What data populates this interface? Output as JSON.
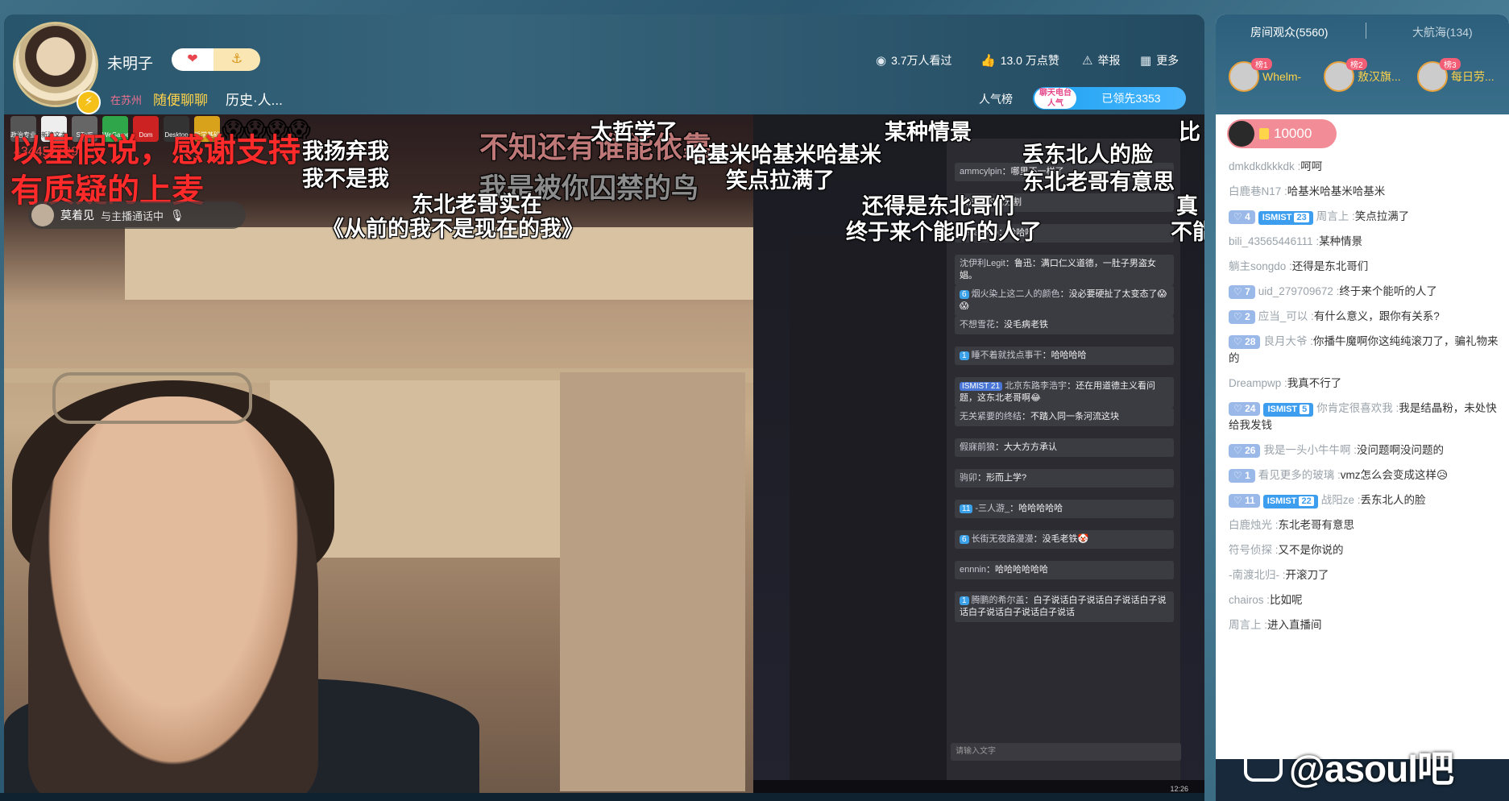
{
  "header": {
    "streamer_name": "未明子",
    "location": "在苏州",
    "category": "随便聊聊",
    "sub_category": "历史·人...",
    "viewers": "3.7万人看过",
    "likes": "13.0 万点赞",
    "report_label": "举报",
    "more_label": "更多",
    "popularity_label": "人气榜",
    "rank_tag": "聊天电台 人气",
    "rank_status": "已领先3353"
  },
  "video": {
    "caller_name": "莫着见",
    "caller_status": "与主播通话中",
    "id_overlay": "434457199",
    "red_overlays": [
      "以基假说，感谢支持",
      "有质疑的上麦"
    ],
    "desktop_icons": [
      "政治专业",
      "新建文本",
      "STelE",
      "WeGame",
      "Dom",
      "Desktop",
      "哲学基础"
    ],
    "emoji_row": "😱😱😱😱",
    "danmaku": [
      "我扬弃我",
      "我不是我",
      "不知还有谁能依靠",
      "太哲学了",
      "哈基米哈基米哈基米",
      "某种情景",
      "比",
      "丢东北人的脸",
      "东北老哥有意思",
      "我是被你囚禁的鸟",
      "笑点拉满了",
      "东北老哥实在",
      "《从前的我不是现在的我》",
      "还得是东北哥们",
      "终于来个能听的人了",
      "真",
      "不能"
    ],
    "monitor_lines": [
      {
        "user": "ammcylpin",
        "text": "哪里不一样了"
      },
      {
        "user": "",
        "text": "和过去的我分割"
      },
      {
        "user": "delta0019",
        "text": "哈哈哈"
      },
      {
        "user": "沈伊利Legit",
        "text": "鲁迅：满口仁义道德，一肚子男盗女娼。"
      },
      {
        "badge": "6",
        "user": "烟火染上这二人的颜色",
        "text": "没必要硬扯了太变态了😱😱"
      },
      {
        "user": "不想雪花",
        "text": "没毛病老铁"
      },
      {
        "badge": "1",
        "user": "睡不着就找点事干",
        "text": "哈哈哈哈"
      },
      {
        "medal": "ISMIST 21",
        "user": "北京东路李浩宇",
        "text": "还在用道德主义看问题，这东北老哥啊😂"
      },
      {
        "user": "无关紧要的终结",
        "text": "不踏入同一条河流这块"
      },
      {
        "user": "假寐前狼",
        "text": "大大方方承认"
      },
      {
        "user": "驹卯",
        "text": "形而上学?"
      },
      {
        "badge": "11",
        "user": "-三人游_",
        "text": "哈哈哈哈哈"
      },
      {
        "badge": "6",
        "user": "长街无夜路漫漫",
        "text": "没毛老铁🤡"
      },
      {
        "user": "ennnin",
        "text": "哈哈哈哈哈哈"
      },
      {
        "badge": "1",
        "user": "腾鹏的希尔盖",
        "text": "白子说话白子说话白子说话白子说话白子说话白子说话白子说话"
      }
    ],
    "monitor_input_placeholder": "请输入文字",
    "monitor_clock": "12:26"
  },
  "right_panel": {
    "tab_audience": "房间观众(5560)",
    "tab_captain": "大航海(134)",
    "top_viewers": [
      {
        "rank": "榜1",
        "name": "Whelm-"
      },
      {
        "rank": "榜2",
        "name": "敖汉旗..."
      },
      {
        "rank": "榜3",
        "name": "每日劳..."
      }
    ],
    "gold_amount": "10000",
    "chat": [
      {
        "user": "dmkdkdkkkdk",
        "msg": "呵呵"
      },
      {
        "user": "白鹿巷N17",
        "msg": "哈基米哈基米哈基米"
      },
      {
        "fan": "4",
        "medal": "ISMIST",
        "medal_lv": "23",
        "user": "周言上",
        "msg": "笑点拉满了"
      },
      {
        "user": "bili_43565446111",
        "msg": "某种情景"
      },
      {
        "user": "躺主songdo",
        "msg": "还得是东北哥们"
      },
      {
        "fan": "7",
        "user": "uid_279709672",
        "msg": "终于来个能听的人了"
      },
      {
        "fan": "2",
        "user": "应当_可以",
        "msg": "有什么意义，跟你有关系?"
      },
      {
        "fan": "28",
        "user": "良月大爷",
        "msg": "你播牛魔啊你这纯纯滚刀了，骗礼物来的"
      },
      {
        "user": "Dreampwp",
        "msg": "我真不行了"
      },
      {
        "fan": "24",
        "medal": "ISMIST",
        "medal_lv": "5",
        "user": "你肯定很喜欢我",
        "msg": "我是结晶粉，未处快给我发钱"
      },
      {
        "fan": "26",
        "user": "我是一头小牛牛啊",
        "msg": "没问题啊没问题的"
      },
      {
        "fan": "1",
        "user": "看见更多的玻璃",
        "msg": "vmz怎么会变成这样😥"
      },
      {
        "fan": "11",
        "medal": "ISMIST",
        "medal_lv": "22",
        "user": "战阳ze",
        "msg": "丢东北人的脸"
      },
      {
        "user": "白鹿烛光",
        "msg": "东北老哥有意思"
      },
      {
        "user": "符号侦探",
        "msg": "又不是你说的"
      },
      {
        "user": "-南渡北归-",
        "msg": "开滚刀了"
      },
      {
        "user": "chairos",
        "msg": "比如呢"
      },
      {
        "user": "周言上",
        "msg": "进入直播间"
      }
    ],
    "watermark": "@asoul吧"
  }
}
